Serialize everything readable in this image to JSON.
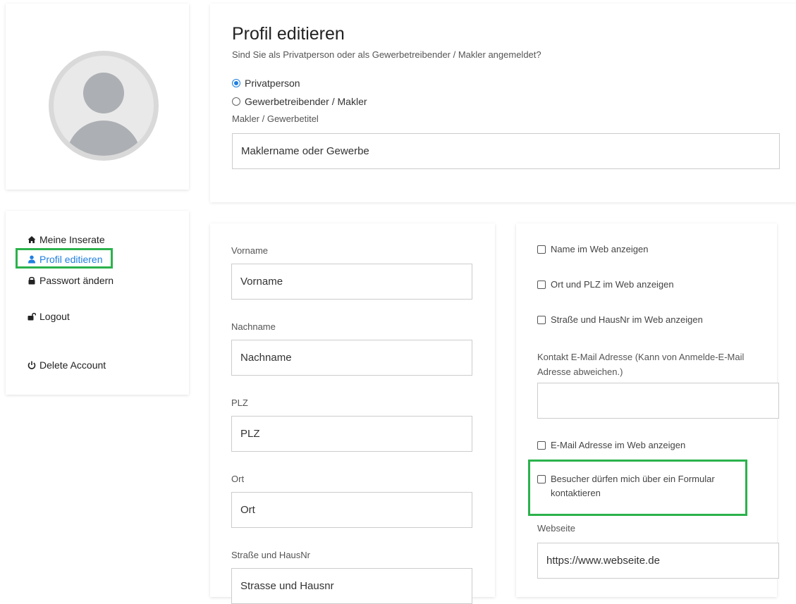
{
  "nav": {
    "items": [
      {
        "label": "Meine Inserate",
        "icon": "home-icon"
      },
      {
        "label": "Profil editieren",
        "icon": "user-icon",
        "active": true
      },
      {
        "label": "Passwort ändern",
        "icon": "lock-icon"
      },
      {
        "label": "Logout",
        "icon": "unlock-icon"
      },
      {
        "label": "Delete Account",
        "icon": "power-icon"
      }
    ]
  },
  "profile": {
    "title": "Profil editieren",
    "question": "Sind Sie als Privatperson oder als Gewerbetreibender / Makler angemeldet?",
    "options": [
      {
        "label": "Privatperson",
        "checked": true
      },
      {
        "label": "Gewerbetreibender / Makler",
        "checked": false
      }
    ],
    "business_label": "Makler / Gewerbetitel",
    "business_placeholder": "Maklername oder Gewerbe"
  },
  "form": {
    "firstname": {
      "label": "Vorname",
      "placeholder": "Vorname"
    },
    "lastname": {
      "label": "Nachname",
      "placeholder": "Nachname"
    },
    "zip": {
      "label": "PLZ",
      "placeholder": "PLZ"
    },
    "city": {
      "label": "Ort",
      "placeholder": "Ort"
    },
    "street": {
      "label": "Straße und HausNr",
      "placeholder": "Strasse und Hausnr"
    }
  },
  "settings": {
    "show_name": "Name im Web anzeigen",
    "show_city": "Ort und PLZ im Web anzeigen",
    "show_street": "Straße und HausNr im Web anzeigen",
    "contact_email_label": "Kontakt E-Mail Adresse (Kann von Anmelde-E-Mail Adresse abweichen.)",
    "contact_email_value": "",
    "show_email": "E-Mail Adresse im Web anzeigen",
    "contact_form": "Besucher dürfen mich über ein Formular kontaktieren",
    "website_label": "Webseite",
    "website_placeholder": "https://www.webseite.de"
  },
  "colors": {
    "accent": "#1f7fe0",
    "highlight": "#2bb24c"
  }
}
